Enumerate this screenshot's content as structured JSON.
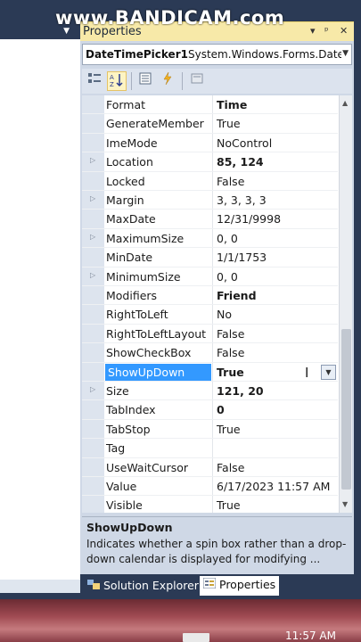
{
  "watermark": "www.BANDICAM.com",
  "properties_window": {
    "title": "Properties",
    "controls": {
      "dropdown": "▾",
      "pin": "ᵖ",
      "close": "✕"
    },
    "object_name": "DateTimePicker1",
    "object_type": "System.Windows.Forms.Date",
    "toolbar": [
      "categorized-icon",
      "alphabetical-icon",
      "properties-icon",
      "events-icon",
      "property-pages-icon"
    ],
    "rows": [
      {
        "name": "Format",
        "value": "Time",
        "bold": true,
        "expandable": false
      },
      {
        "name": "GenerateMember",
        "value": "True",
        "bold": false,
        "expandable": false
      },
      {
        "name": "ImeMode",
        "value": "NoControl",
        "bold": false,
        "expandable": false
      },
      {
        "name": "Location",
        "value": "85, 124",
        "bold": true,
        "expandable": true
      },
      {
        "name": "Locked",
        "value": "False",
        "bold": false,
        "expandable": false
      },
      {
        "name": "Margin",
        "value": "3, 3, 3, 3",
        "bold": false,
        "expandable": true
      },
      {
        "name": "MaxDate",
        "value": "12/31/9998",
        "bold": false,
        "expandable": false
      },
      {
        "name": "MaximumSize",
        "value": "0, 0",
        "bold": false,
        "expandable": true
      },
      {
        "name": "MinDate",
        "value": "1/1/1753",
        "bold": false,
        "expandable": false
      },
      {
        "name": "MinimumSize",
        "value": "0, 0",
        "bold": false,
        "expandable": true
      },
      {
        "name": "Modifiers",
        "value": "Friend",
        "bold": true,
        "expandable": false
      },
      {
        "name": "RightToLeft",
        "value": "No",
        "bold": false,
        "expandable": false
      },
      {
        "name": "RightToLeftLayout",
        "value": "False",
        "bold": false,
        "expandable": false
      },
      {
        "name": "ShowCheckBox",
        "value": "False",
        "bold": false,
        "expandable": false
      },
      {
        "name": "ShowUpDown",
        "value": "True",
        "bold": true,
        "expandable": false,
        "selected": true
      },
      {
        "name": "Size",
        "value": "121, 20",
        "bold": true,
        "expandable": true
      },
      {
        "name": "TabIndex",
        "value": "0",
        "bold": true,
        "expandable": false
      },
      {
        "name": "TabStop",
        "value": "True",
        "bold": false,
        "expandable": false
      },
      {
        "name": "Tag",
        "value": "",
        "bold": false,
        "expandable": false
      },
      {
        "name": "UseWaitCursor",
        "value": "False",
        "bold": false,
        "expandable": false
      },
      {
        "name": "Value",
        "value": "6/17/2023 11:57 AM",
        "bold": false,
        "expandable": false
      },
      {
        "name": "Visible",
        "value": "True",
        "bold": false,
        "expandable": false
      }
    ],
    "description": {
      "title": "ShowUpDown",
      "text": "Indicates whether a spin box rather than a drop-down calendar is displayed for modifying ..."
    }
  },
  "tabs": [
    {
      "label": "Solution Explorer",
      "icon": "solution-explorer-icon",
      "active": false
    },
    {
      "label": "Properties",
      "icon": "properties-icon",
      "active": true
    }
  ],
  "taskbar": {
    "clock": "11:57 AM"
  },
  "colors": {
    "selection": "#3399ff",
    "title_bar": "#f7e9a8",
    "panel": "#cfd8e6",
    "chrome": "#2b3a55"
  }
}
